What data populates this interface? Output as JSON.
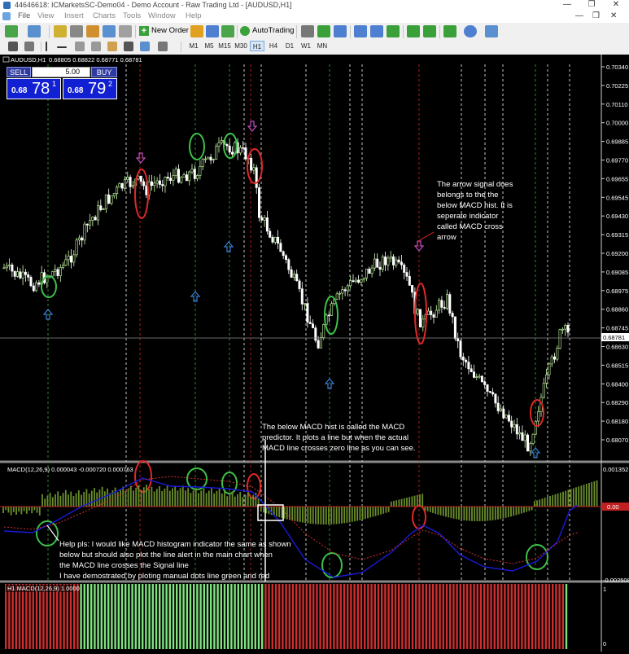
{
  "window": {
    "title": "44646618: ICMarketsSC-Demo04 - Demo Account - Raw Trading Ltd - [AUDUSD,H1]",
    "minimize_glyph": "—",
    "maximize_glyph": "❐",
    "close_glyph": "✕"
  },
  "menu": {
    "items": [
      "File",
      "View",
      "Insert",
      "Charts",
      "Tools",
      "Window",
      "Help"
    ],
    "mdi_minimize": "—",
    "mdi_restore": "❐",
    "mdi_close": "✕"
  },
  "toolbar": {
    "new_order_label": "New Order",
    "autotrading_label": "AutoTrading",
    "timeframes": [
      "M1",
      "M5",
      "M15",
      "M30",
      "H1",
      "H4",
      "D1",
      "W1",
      "MN"
    ],
    "active_timeframe": "H1",
    "icons": [
      "new-chart-icon",
      "profiles-icon",
      "market-watch-icon",
      "data-window-icon",
      "navigator-icon",
      "terminal-icon",
      "strategy-tester-icon",
      "new-order-icon",
      "metaeditor-icon",
      "autotrading-icon",
      "bar-chart-icon",
      "candlestick-icon",
      "line-chart-icon",
      "zoom-in-icon",
      "zoom-out-icon",
      "tile-windows-icon",
      "autoscroll-icon",
      "chart-shift-icon",
      "indicators-icon",
      "periods-icon",
      "templates-icon",
      "cursor-icon",
      "crosshair-icon",
      "vertical-line-icon",
      "horizontal-line-icon",
      "trendline-icon",
      "equidistant-channel-icon",
      "fibonacci-icon",
      "text-icon",
      "text-label-icon",
      "arrows-icon"
    ]
  },
  "chart": {
    "symbol_header": "AUDUSD,H1",
    "ohlc_header": "0.68805 0.68822 0.68771 0.68781",
    "price_scale": [
      "0.70340",
      "0.70225",
      "0.70110",
      "0.70000",
      "0.69885",
      "0.69770",
      "0.69655",
      "0.69545",
      "0.69430",
      "0.69315",
      "0.69200",
      "0.69085",
      "0.68975",
      "0.68860",
      "0.68745",
      "0.68630",
      "0.68515",
      "0.68400",
      "0.68290",
      "0.68180",
      "0.68070"
    ],
    "current_price": "0.68781",
    "trade_panel": {
      "sell_label": "SELL",
      "buy_label": "BUY",
      "lot_value": "5.00",
      "sell_small": "0.68",
      "sell_big": "78",
      "sell_sup": "1",
      "buy_small": "0.68",
      "buy_big": "79",
      "buy_sup": "2"
    },
    "annotation_arrow_signal": [
      "The arrow signal does",
      "belongs to the the",
      "below MACD hist. It is",
      "seperate indicator",
      "called MACD cross",
      "arrow"
    ],
    "annotation_predictor": [
      "The below MACD hist is called the MACD",
      "predictor. It plots a line but when the actual",
      "MACD line crosses zero line as you can see."
    ]
  },
  "macd_panel": {
    "header": "MACD(12,26,9) 0.000043 -0.000720 0.000763",
    "scale_top": "0.001352",
    "scale_zero": "0.00",
    "scale_bottom": "-0.002508",
    "annotation_help": [
      "Help pls: I would like MACD histogram indicator the same as shown",
      "below but should also plot the line alert in the main chart when",
      "the MACD line crosses the Signal line",
      "I have demostrated by ploting manual dots line green and red"
    ]
  },
  "h1_panel": {
    "header": "H1 MACD(12,26,9) 1.0000",
    "scale_top": "1",
    "scale_bottom": "0"
  },
  "colors": {
    "background": "#000000",
    "bull_candle": "#ccffaa",
    "bear_candle": "#ffffff",
    "vline_green": "#2f9a2f",
    "vline_red": "#c02020",
    "vline_white": "#d9d9d9",
    "circle_green": "#3ec04a",
    "circle_red": "#e02828",
    "arrow_up": "#3a7fd5",
    "arrow_down": "#c050c0",
    "macd_hist": "#6b8e2b",
    "macd_main": "#1a1ad8",
    "macd_signal": "#d03030",
    "bar_green": "#7fe37f",
    "bar_red": "#cc2f2f"
  }
}
